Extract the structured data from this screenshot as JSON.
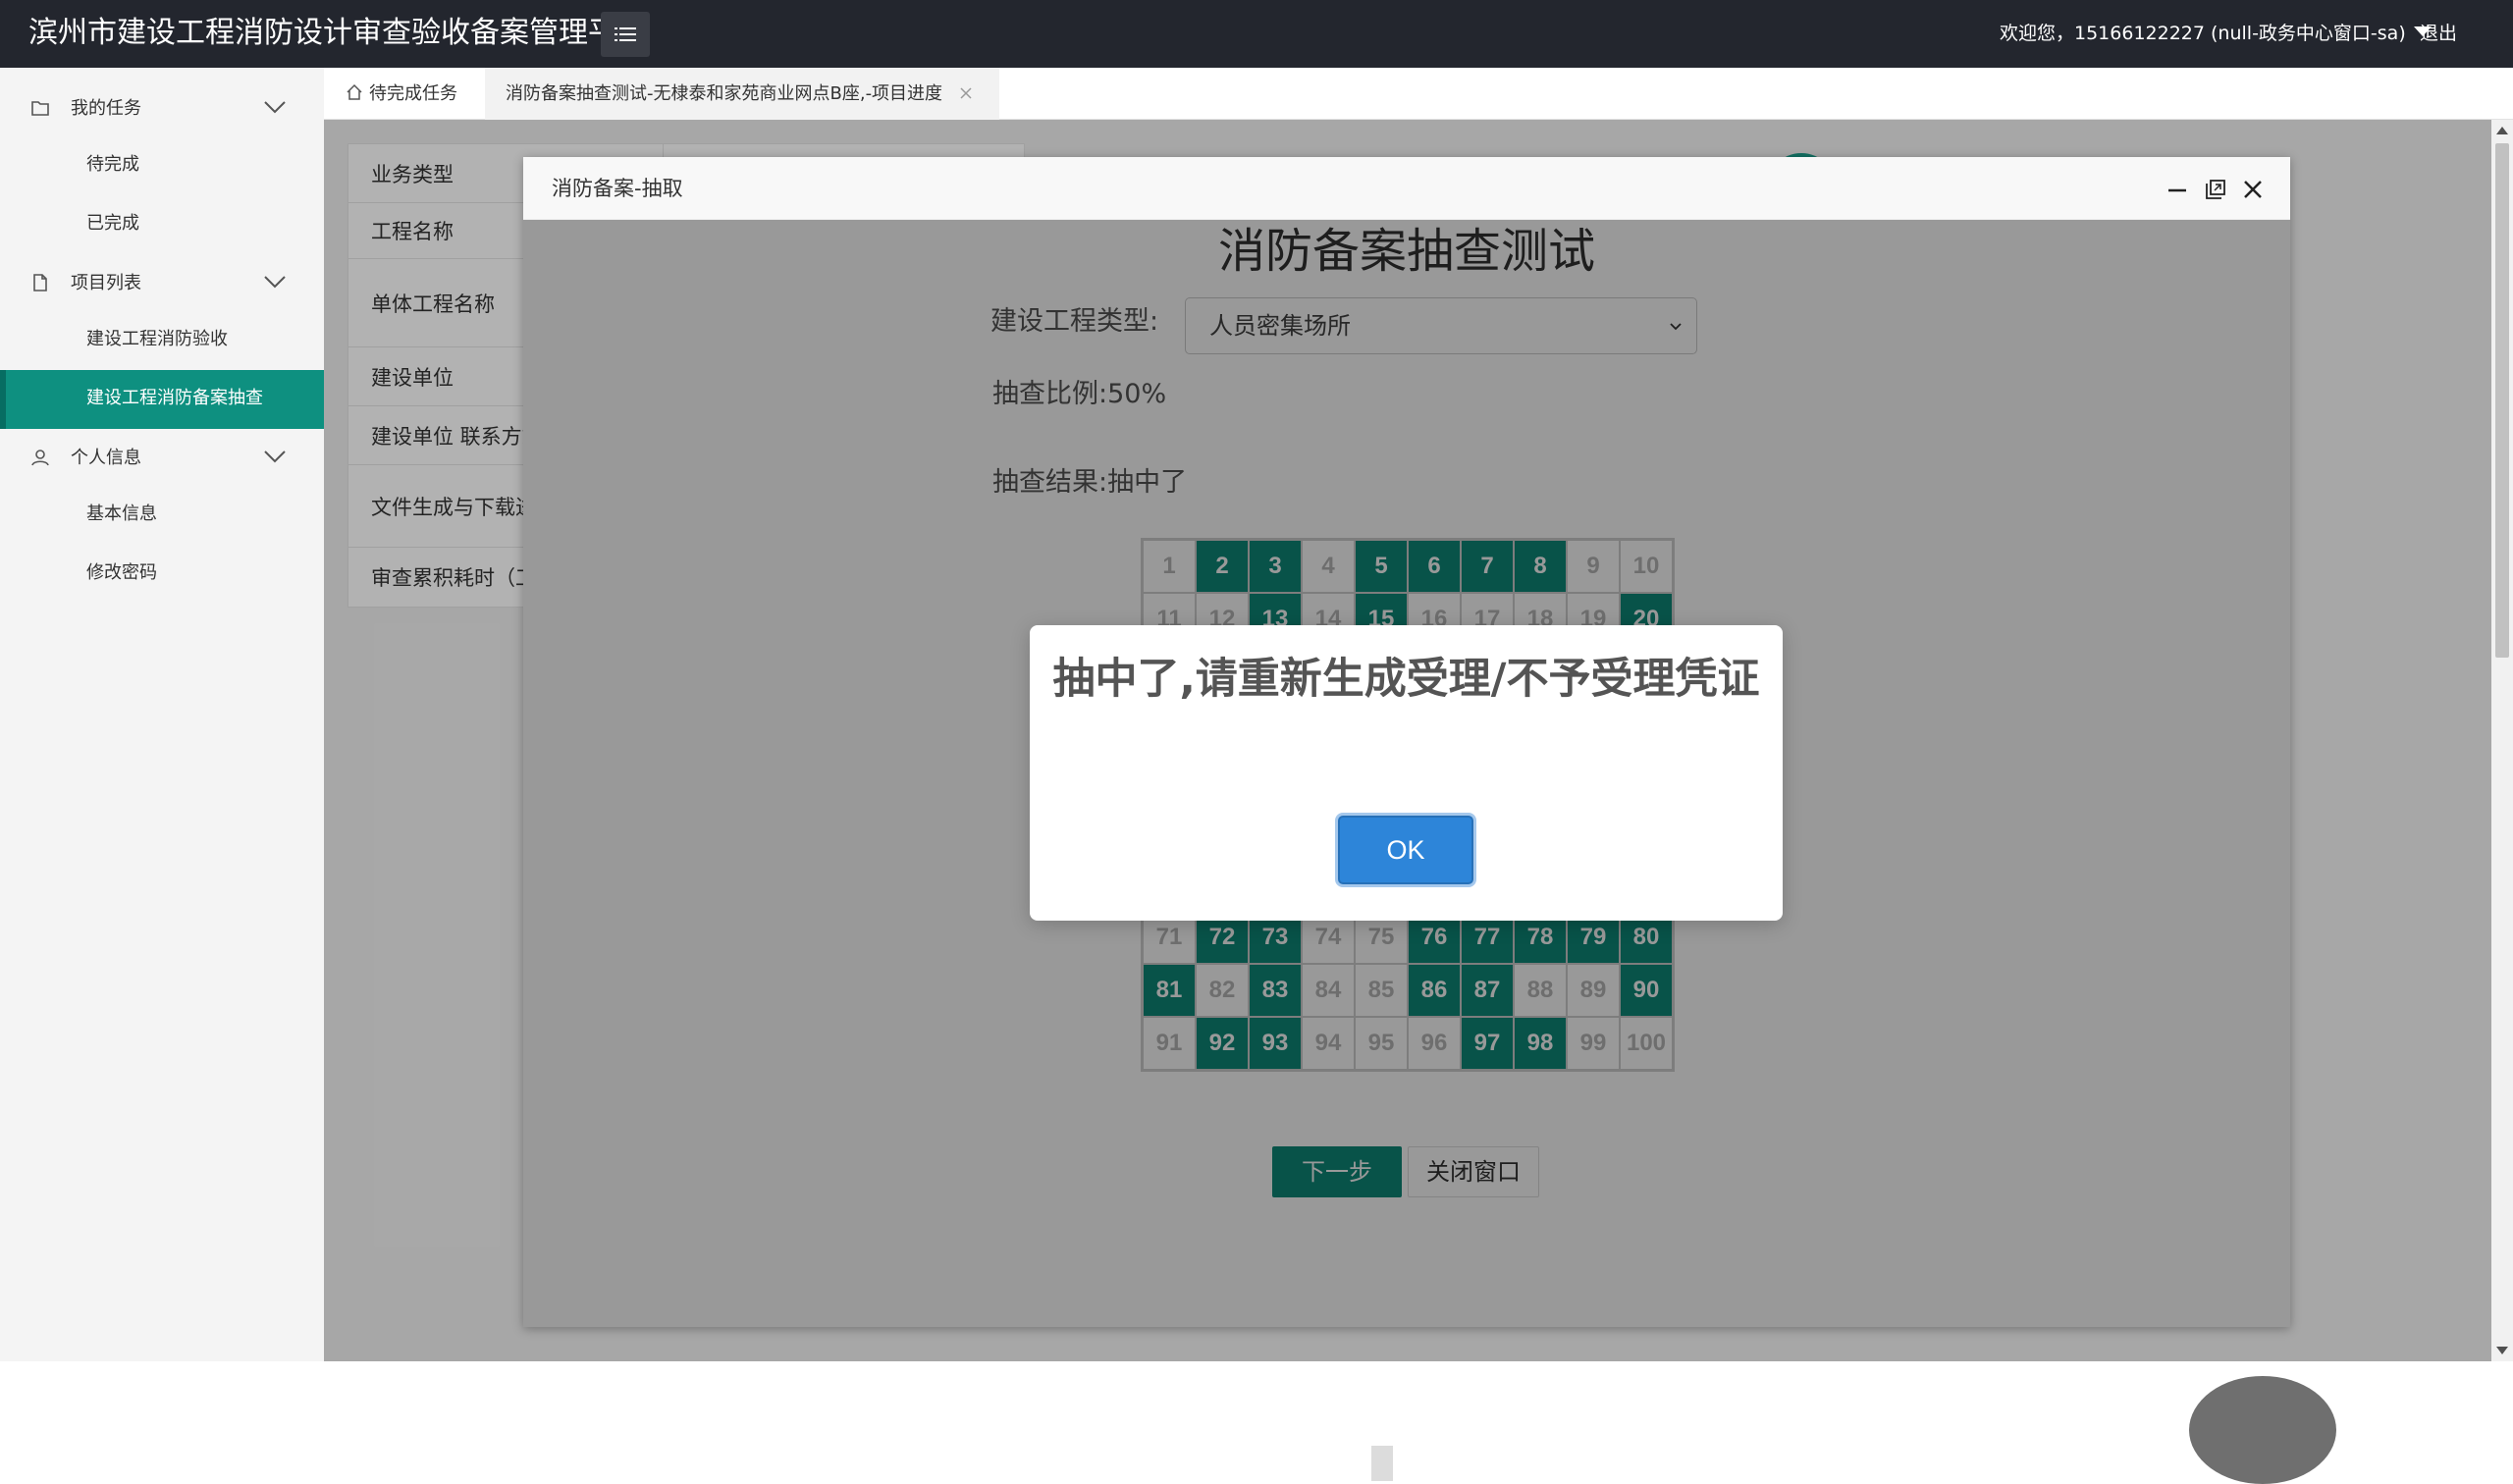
{
  "header": {
    "title": "滨州市建设工程消防设计审查验收备案管理平台",
    "welcome": "欢迎您，15166122227 (null-政务中心窗口-sa)",
    "logout": "退出"
  },
  "sidebar": {
    "groups": [
      {
        "label": "我的任务",
        "icon": "folder-icon",
        "items": [
          "待完成",
          "已完成"
        ]
      },
      {
        "label": "项目列表",
        "icon": "document-icon",
        "items": [
          "建设工程消防验收",
          "建设工程消防备案抽查"
        ]
      },
      {
        "label": "个人信息",
        "icon": "user-icon",
        "items": [
          "基本信息",
          "修改密码"
        ]
      }
    ],
    "active_item": "建设工程消防备案抽查"
  },
  "tabs": {
    "home": "待完成任务",
    "current": "消防备案抽查测试-无棣泰和家苑商业网点B座,-项目进度"
  },
  "form": {
    "rows": [
      "业务类型",
      "工程名称",
      "单体工程名称",
      "建设单位",
      "建设单位 联系方式",
      "文件生成与下载进度",
      "审查累积耗时（工作日）"
    ]
  },
  "layer": {
    "title": "消防备案-抽取",
    "heading": "消防备案抽查测试",
    "type_label": "建设工程类型:",
    "type_value": "人员密集场所",
    "ratio": "抽查比例:50%",
    "result": "抽查结果:抽中了",
    "selected_numbers": [
      2,
      3,
      5,
      6,
      7,
      8,
      13,
      15,
      20,
      72,
      73,
      76,
      77,
      78,
      79,
      80,
      81,
      83,
      86,
      87,
      90,
      92,
      93,
      97,
      98
    ],
    "next_button": "下一步",
    "close_button": "关闭窗口"
  },
  "alert": {
    "message": "抽中了,请重新生成受理/不予受理凭证",
    "ok": "OK"
  },
  "colors": {
    "header_bg": "#23262e",
    "accent": "#0e8a7b",
    "alert_button": "#2d85d9"
  }
}
